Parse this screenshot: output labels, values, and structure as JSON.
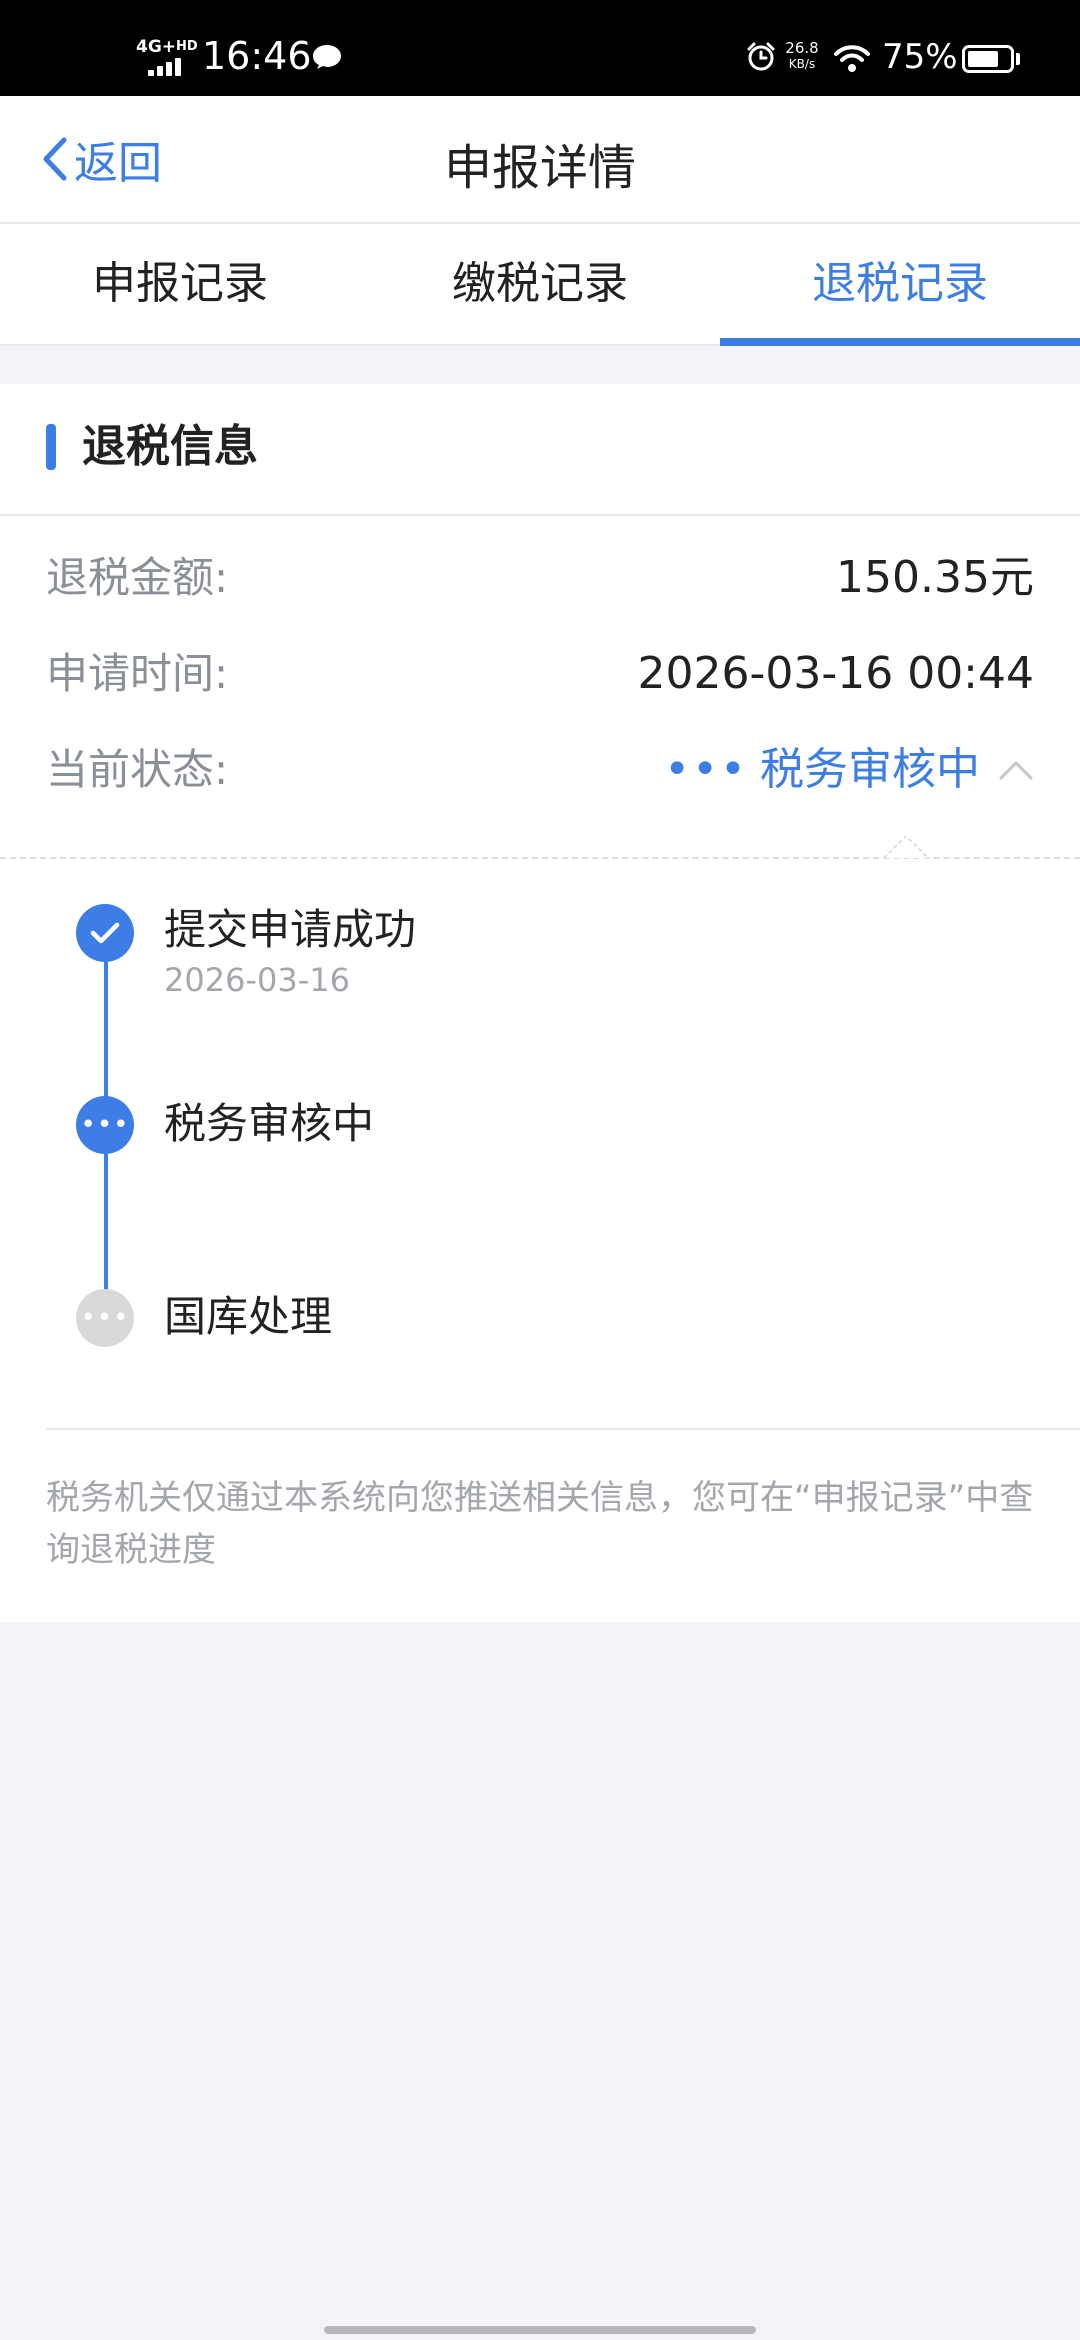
{
  "status_bar": {
    "network": "4G+",
    "hd": "HD",
    "time": "16:46",
    "speed_value": "26.8",
    "speed_unit": "KB/s",
    "battery_percent": "75%",
    "battery_level": 0.75,
    "icons": [
      "signal-icon",
      "message-icon",
      "alarm-icon",
      "wifi-icon",
      "battery-icon"
    ]
  },
  "navbar": {
    "back_label": "返回",
    "title": "申报详情"
  },
  "tabs": [
    {
      "label": "申报记录",
      "active": false
    },
    {
      "label": "缴税记录",
      "active": false
    },
    {
      "label": "退税记录",
      "active": true
    }
  ],
  "refund": {
    "section_title": "退税信息",
    "amount_label": "退税金额:",
    "amount_value": "150.35元",
    "apply_time_label": "申请时间:",
    "apply_time_value": "2026-03-16 00:44",
    "status_label": "当前状态:",
    "status_value": "税务审核中"
  },
  "timeline": [
    {
      "title": "提交申请成功",
      "date": "2026-03-16",
      "state": "done"
    },
    {
      "title": "税务审核中",
      "state": "current"
    },
    {
      "title": "国库处理",
      "state": "pending"
    }
  ],
  "notice": "税务机关仅通过本系统向您推送相关信息，您可在“申报记录”中查询退税进度",
  "colors": {
    "accent": "#3d7ee6",
    "pending": "#d9d9d9",
    "background": "#f2f4f8"
  }
}
